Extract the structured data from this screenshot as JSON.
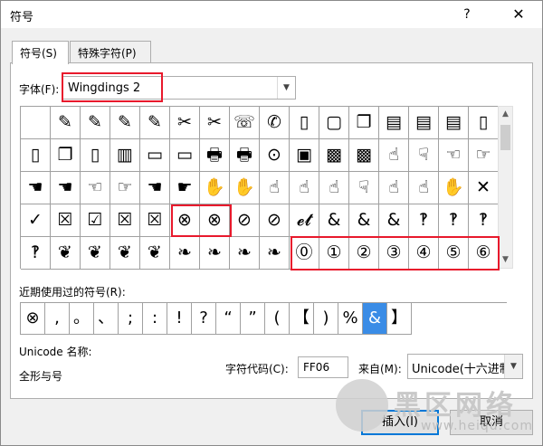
{
  "window": {
    "title": "符号",
    "help": "?",
    "close": "✕"
  },
  "tabs": [
    {
      "label": "符号(S)"
    },
    {
      "label": "特殊字符(P)"
    }
  ],
  "font": {
    "label": "字体(F):",
    "value": "Wingdings 2"
  },
  "grid_rows": [
    [
      "",
      "✎",
      "✎",
      "✎",
      "✎",
      "✂",
      "✂",
      "☏",
      "✆",
      "▯",
      "▢",
      "❐",
      "▤",
      "▤",
      "▤",
      "▯"
    ],
    [
      "▯",
      "❐",
      "▯",
      "▥",
      "▭",
      "▭",
      "🖶",
      "🖶",
      "⊙",
      "▣",
      "▩",
      "▩",
      "☝",
      "☟",
      "☜",
      "☞"
    ],
    [
      "☚",
      "☚",
      "☜",
      "☞",
      "☚",
      "☛",
      "✋",
      "✋",
      "☝",
      "☝",
      "☝",
      "☟",
      "☝",
      "☝",
      "✋",
      "✕"
    ],
    [
      "✓",
      "☒",
      "☑",
      "☒",
      "☒",
      "⊗",
      "⊗",
      "⊘",
      "⊘",
      "𝓮𝓽",
      "&",
      "&",
      "&",
      "‽",
      "‽",
      "‽"
    ],
    [
      "‽",
      "❦",
      "❦",
      "❦",
      "❦",
      "❧",
      "❧",
      "❧",
      "❧",
      "⓪",
      "①",
      "②",
      "③",
      "④",
      "⑤",
      "⑥"
    ]
  ],
  "recent": {
    "label": "近期使用过的符号(R):",
    "symbols": [
      "⊗",
      ",",
      "。",
      "、",
      ";",
      ":",
      "!",
      "?",
      "“",
      "”",
      "(",
      "【",
      ")",
      "%",
      "&",
      "】"
    ]
  },
  "unicode_name": {
    "label": "Unicode 名称:",
    "value": "全形与号"
  },
  "char_code": {
    "label": "字符代码(C):",
    "value": "FF06"
  },
  "from": {
    "label": "来自(M):",
    "value": "Unicode(十六进制)"
  },
  "buttons": {
    "insert": "插入(I)",
    "cancel": "取消"
  },
  "watermark": {
    "text": "黑区网络",
    "url": "www.heiqu.com"
  },
  "colors": {
    "highlight_red": "#e8192c",
    "selection_blue": "#3a8ce6"
  }
}
